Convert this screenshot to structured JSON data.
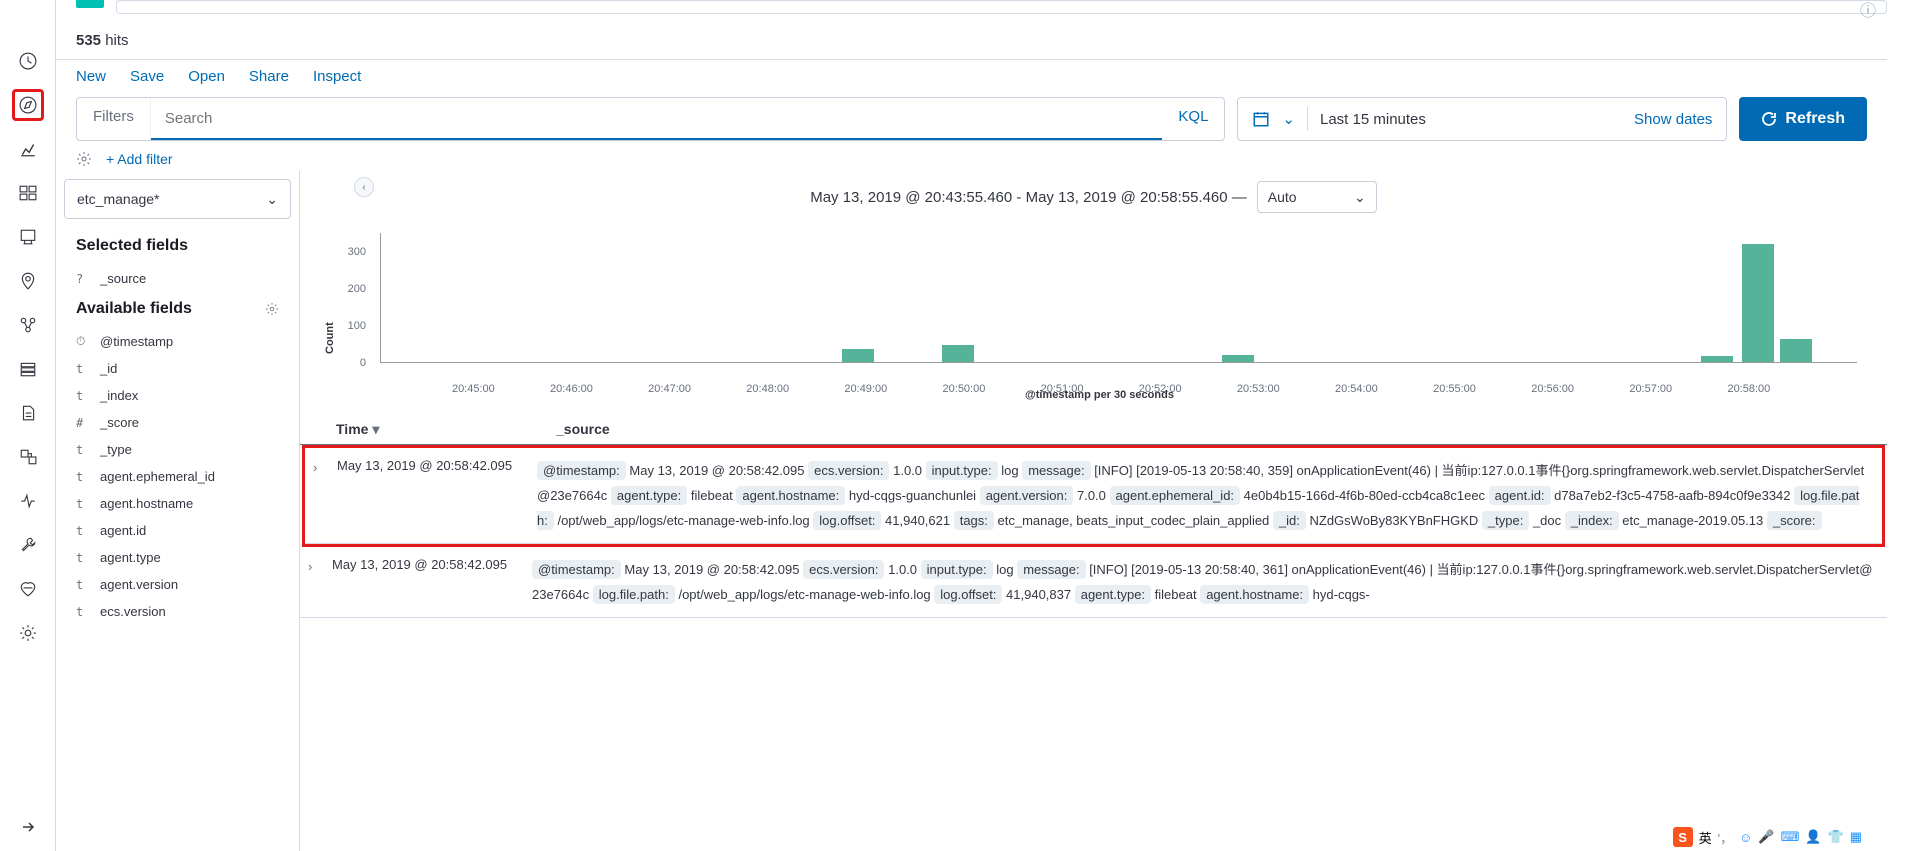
{
  "hits": {
    "count": "535",
    "label": "hits"
  },
  "menu": {
    "new": "New",
    "save": "Save",
    "open": "Open",
    "share": "Share",
    "inspect": "Inspect"
  },
  "search": {
    "filters_label": "Filters",
    "placeholder": "Search",
    "kql": "KQL"
  },
  "time": {
    "range": "Last 15 minutes",
    "show_dates": "Show dates"
  },
  "refresh": {
    "label": "Refresh"
  },
  "add_filter": {
    "label": "+ Add filter"
  },
  "index_pattern": {
    "selected": "etc_manage*"
  },
  "fields": {
    "selected_title": "Selected fields",
    "available_title": "Available fields",
    "selected": [
      {
        "type": "?",
        "name": "_source"
      }
    ],
    "available": [
      {
        "type": "⏱",
        "name": "@timestamp"
      },
      {
        "type": "t",
        "name": "_id"
      },
      {
        "type": "t",
        "name": "_index"
      },
      {
        "type": "#",
        "name": "_score"
      },
      {
        "type": "t",
        "name": "_type"
      },
      {
        "type": "t",
        "name": "agent.ephemeral_id"
      },
      {
        "type": "t",
        "name": "agent.hostname"
      },
      {
        "type": "t",
        "name": "agent.id"
      },
      {
        "type": "t",
        "name": "agent.type"
      },
      {
        "type": "t",
        "name": "agent.version"
      },
      {
        "type": "t",
        "name": "ecs.version"
      }
    ]
  },
  "chart_header": {
    "range": "May 13, 2019 @ 20:43:55.460 - May 13, 2019 @ 20:58:55.460 —",
    "auto": "Auto"
  },
  "chart_data": {
    "type": "bar",
    "title": "",
    "ylabel": "Count",
    "xlabel": "@timestamp per 30 seconds",
    "ylim": [
      0,
      350
    ],
    "y_ticks": [
      0,
      100,
      200,
      300
    ],
    "x_ticks": [
      "20:45:00",
      "20:46:00",
      "20:47:00",
      "20:48:00",
      "20:49:00",
      "20:50:00",
      "20:51:00",
      "20:52:00",
      "20:53:00",
      "20:54:00",
      "20:55:00",
      "20:56:00",
      "20:57:00",
      "20:58:00"
    ],
    "bars": [
      {
        "x_pct": 31.2,
        "value": 35
      },
      {
        "x_pct": 38.0,
        "value": 45
      },
      {
        "x_pct": 57.0,
        "value": 20
      },
      {
        "x_pct": 89.4,
        "value": 15
      },
      {
        "x_pct": 92.2,
        "value": 320
      },
      {
        "x_pct": 94.8,
        "value": 62
      }
    ]
  },
  "table": {
    "time_header": "Time",
    "source_header": "_source"
  },
  "docs": [
    {
      "time": "May 13, 2019 @ 20:58:42.095",
      "fields": {
        "@timestamp": "May 13, 2019 @ 20:58:42.095",
        "ecs.version": "1.0.0",
        "input.type": "log",
        "message": "[INFO] [2019-05-13 20:58:40, 359] onApplicationEvent(46) | 当前ip:127.0.0.1事件{}org.springframework.web.servlet.DispatcherServlet@23e7664c",
        "agent.type": "filebeat",
        "agent.hostname": "hyd-cqgs-guanchunlei",
        "agent.version": "7.0.0",
        "agent.ephemeral_id": "4e0b4b15-166d-4f6b-80ed-ccb4ca8c1eec",
        "agent.id": "d78a7eb2-f3c5-4758-aafb-894c0f9e3342",
        "log.file.path": "/opt/web_app/logs/etc-manage-web-info.log",
        "log.offset": "41,940,621",
        "tags": "etc_manage, beats_input_codec_plain_applied",
        "_id": "NZdGsWoBy83KYBnFHGKD",
        "_type": "_doc",
        "_index": "etc_manage-2019.05.13",
        "_score": ""
      }
    },
    {
      "time": "May 13, 2019 @ 20:58:42.095",
      "fields": {
        "@timestamp": "May 13, 2019 @ 20:58:42.095",
        "ecs.version": "1.0.0",
        "input.type": "log",
        "message": "[INFO] [2019-05-13 20:58:40, 361] onApplicationEvent(46) | 当前ip:127.0.0.1事件{}org.springframework.web.servlet.DispatcherServlet@23e7664c",
        "log.file.path": "/opt/web_app/logs/etc-manage-web-info.log",
        "log.offset": "41,940,837",
        "agent.type": "filebeat",
        "agent.hostname": "hyd-cqgs-"
      }
    }
  ],
  "ime": {
    "lang": "英"
  }
}
